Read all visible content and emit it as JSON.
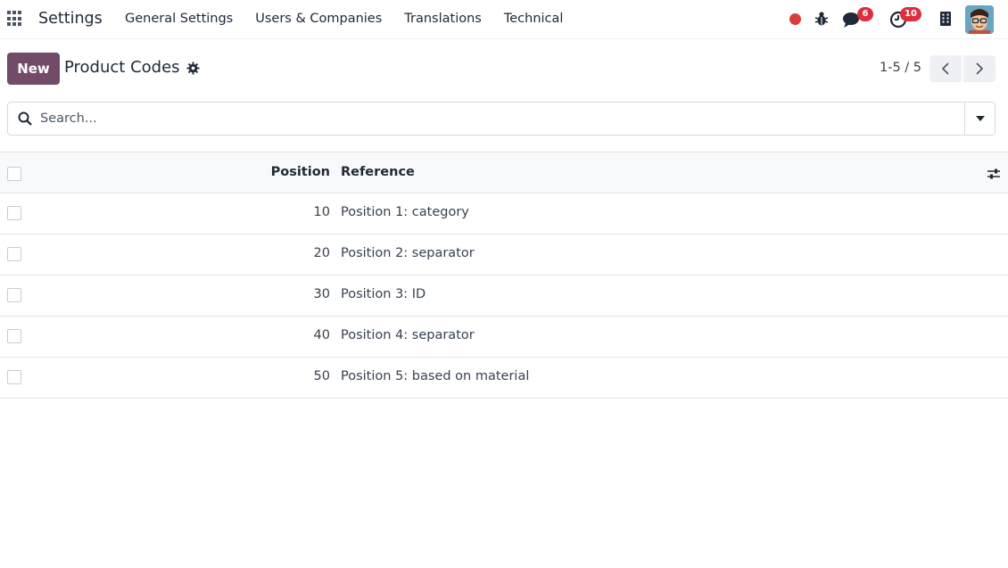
{
  "navbar": {
    "brand": "Settings",
    "menu": [
      "General Settings",
      "Users & Companies",
      "Translations",
      "Technical"
    ],
    "chat_badge": "6",
    "activity_badge": "10"
  },
  "control": {
    "new_label": "New",
    "title": "Product Codes",
    "pager": "1-5 / 5"
  },
  "search": {
    "placeholder": "Search..."
  },
  "table": {
    "headers": {
      "position": "Position",
      "reference": "Reference"
    },
    "rows": [
      {
        "position": "10",
        "reference": "Position 1: category"
      },
      {
        "position": "20",
        "reference": "Position 2: separator"
      },
      {
        "position": "30",
        "reference": "Position 3: ID"
      },
      {
        "position": "40",
        "reference": "Position 4: separator"
      },
      {
        "position": "50",
        "reference": "Position 5: based on material"
      }
    ]
  },
  "colors": {
    "primary": "#714b67",
    "badge": "#dc2f3c",
    "recording": "#dc3c3c"
  }
}
